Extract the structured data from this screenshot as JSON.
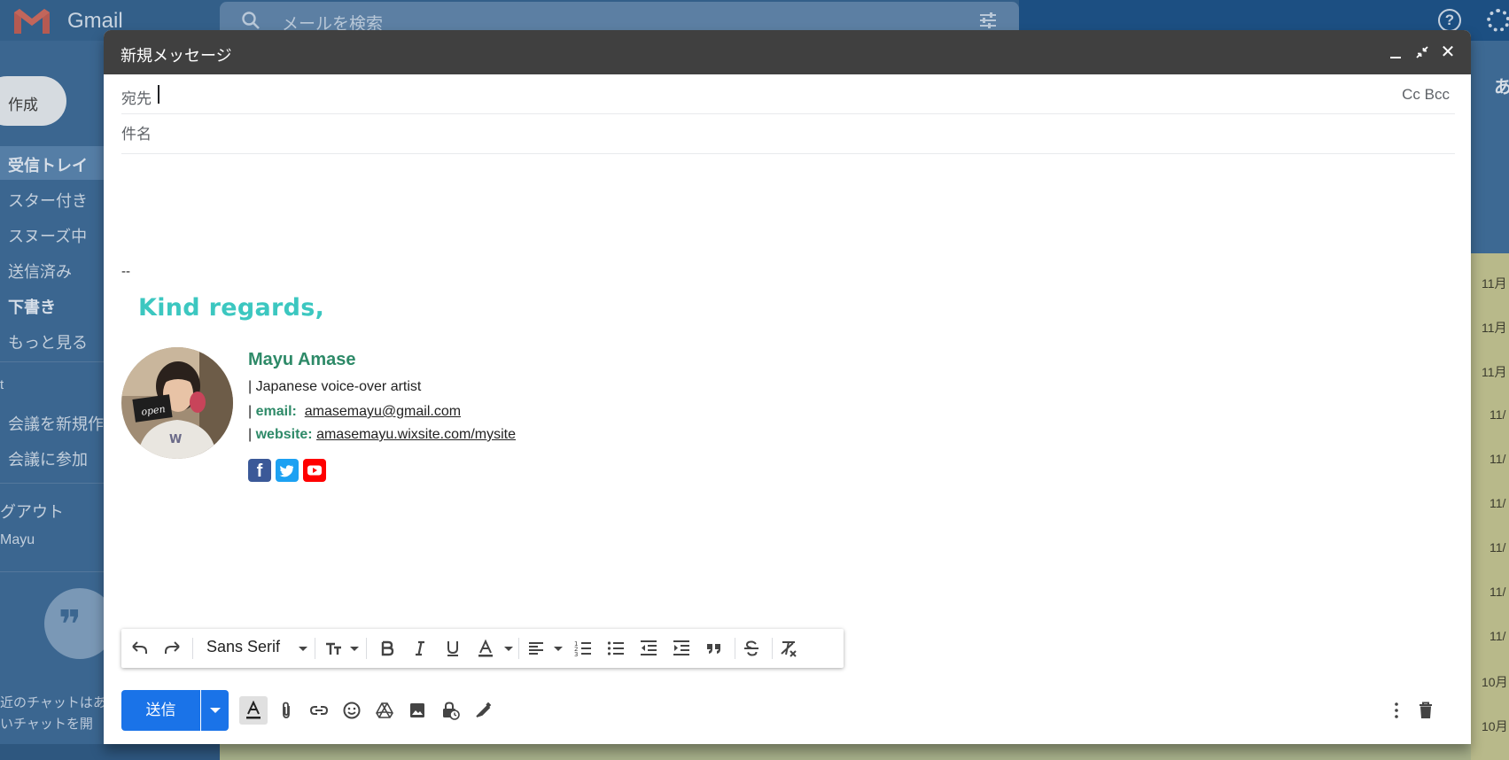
{
  "background": {
    "app_name": "Gmail",
    "search_placeholder": "メールを検索",
    "compose_label": "作成",
    "nav": [
      "受信トレイ",
      "スター付き",
      "スヌーズ中",
      "送信済み",
      "下書き",
      "もっと見る"
    ],
    "meet_title": "t",
    "meet_items": [
      "会議を新規作",
      "会議に参加"
    ],
    "hangout_title": "グアウト",
    "hangout_user": "Mayu",
    "chat_text": [
      "近のチャットはあ",
      "いチャットを開"
    ],
    "right_badge": "あ",
    "dates": [
      "11月",
      "11月",
      "11月",
      "11/",
      "11/",
      "11/",
      "11/",
      "11/",
      "11/",
      "10月",
      "10月"
    ]
  },
  "compose": {
    "title": "新規メッセージ",
    "to_label": "宛先",
    "cc_bcc": "Cc Bcc",
    "subject_placeholder": "件名",
    "signature": {
      "separator": "--",
      "regards": "Kind regards,",
      "photo_sign_text": "open",
      "name": "Mayu Amase",
      "role": "| Japanese voice-over artist",
      "email_prefix": "| ",
      "email_key": "email:",
      "email_value": "amasemayu@gmail.com",
      "website_prefix": "| ",
      "website_key": "website:",
      "website_value": "amasemayu.wixsite.com/mysite",
      "social": [
        "facebook",
        "twitter",
        "youtube"
      ]
    },
    "toolbar": {
      "font": "Sans Serif",
      "icons": [
        "undo-icon",
        "redo-icon",
        "font-size-icon",
        "bold-icon",
        "italic-icon",
        "underline-icon",
        "text-color-icon",
        "align-icon",
        "numbered-list-icon",
        "bulleted-list-icon",
        "indent-less-icon",
        "indent-more-icon",
        "quote-icon",
        "strikethrough-icon",
        "remove-formatting-icon"
      ]
    },
    "send_label": "送信",
    "colors": {
      "header": "#404040",
      "send": "#1a73e8",
      "regards": "#3cc7c0",
      "signature_accent": "#2e8a68"
    }
  }
}
